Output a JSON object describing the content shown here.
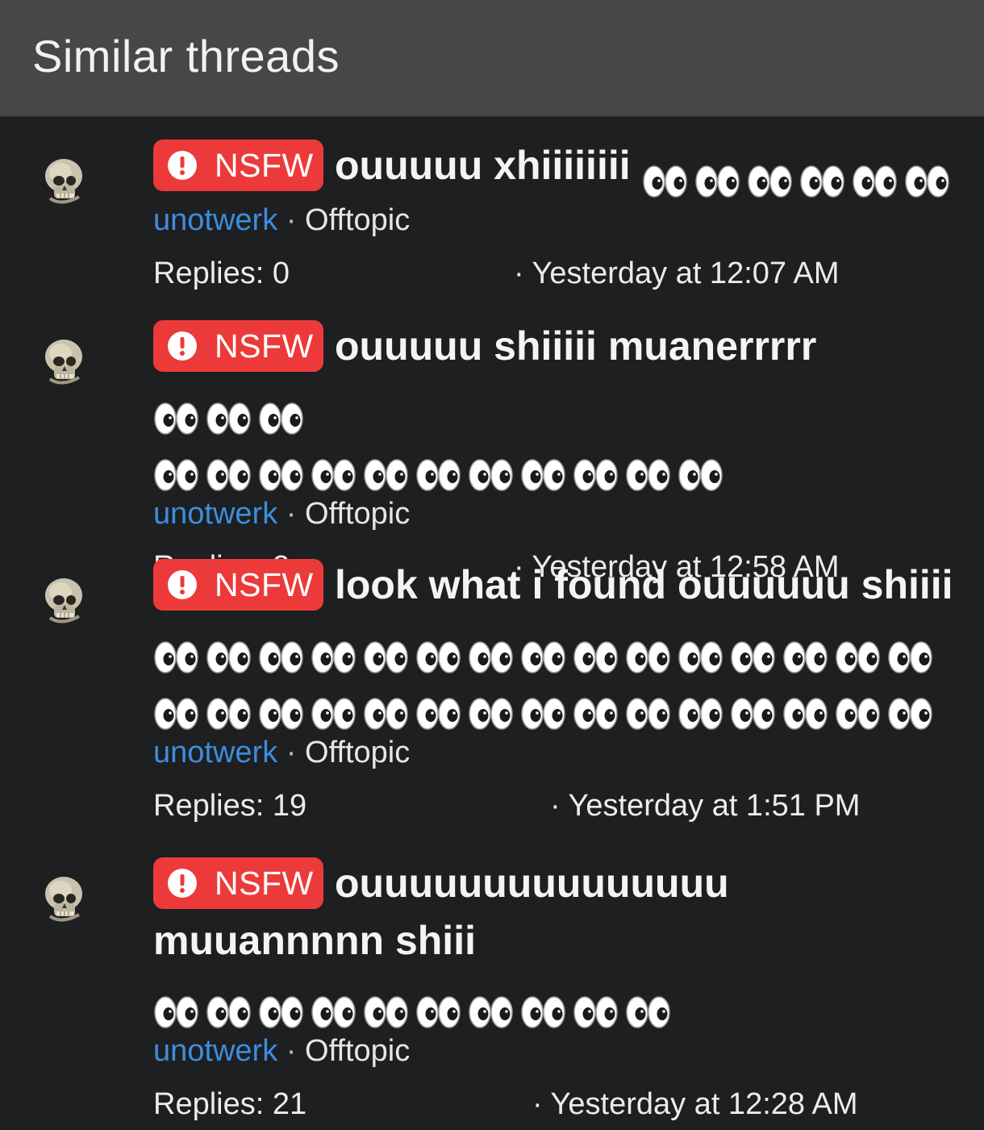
{
  "header": {
    "title": "Similar threads"
  },
  "badge": {
    "label": "NSFW"
  },
  "threads": [
    {
      "title": "ouuuuu xhiiiiiiii",
      "eyes_inline": 6,
      "eyes_rows": [],
      "author": "unotwerk",
      "separator": "·",
      "forum": "Offtopic",
      "replies": "Replies: 0",
      "date": "· Yesterday at 12:07 AM"
    },
    {
      "title": "ouuuuu shiiiii muanerrrrr",
      "eyes_inline": 3,
      "eyes_rows": [
        11
      ],
      "author": "unotwerk",
      "separator": "·",
      "forum": "Offtopic",
      "replies": "Replies: 2",
      "date": "· Yesterday at 12:58 AM"
    },
    {
      "title": "look what i found ouuuuuu shiiii",
      "eyes_inline": 0,
      "eyes_rows": [
        15,
        15
      ],
      "author": "unotwerk",
      "separator": "·",
      "forum": "Offtopic",
      "replies": "Replies: 19",
      "date": "· Yesterday at 1:51 PM"
    },
    {
      "title": "ouuuuuuuuuuuuuuu muuannnnn shiii",
      "eyes_inline": 10,
      "eyes_rows": [],
      "author": "unotwerk",
      "separator": "·",
      "forum": "Offtopic",
      "replies": "Replies: 21",
      "date": "· Yesterday at 12:28 AM"
    }
  ],
  "icons": {
    "avatar": "skull-icon",
    "badge": "exclamation-circle-icon",
    "emoji": "eyes-emoji-icon"
  },
  "colors": {
    "background": "#1e1f20",
    "header": "#474747",
    "badge": "#ec3a3a",
    "author_link": "#3d8de0"
  }
}
